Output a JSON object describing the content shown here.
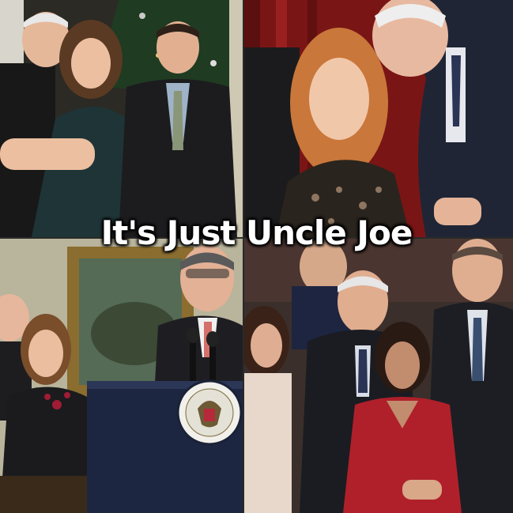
{
  "caption": "It's Just Uncle Joe",
  "seal": {
    "text": "VICE PRESIDENT OF THE UNITED STATES"
  },
  "panels": [
    {
      "name": "top-left",
      "depicts": "photo"
    },
    {
      "name": "top-right",
      "depicts": "photo"
    },
    {
      "name": "bottom-left",
      "depicts": "photo"
    },
    {
      "name": "bottom-right",
      "depicts": "photo"
    }
  ],
  "colors": {
    "caption_text": "#ffffff",
    "caption_outline": "#000000",
    "curtain_red": "#8b1a1a",
    "dress_red": "#b0202a"
  }
}
